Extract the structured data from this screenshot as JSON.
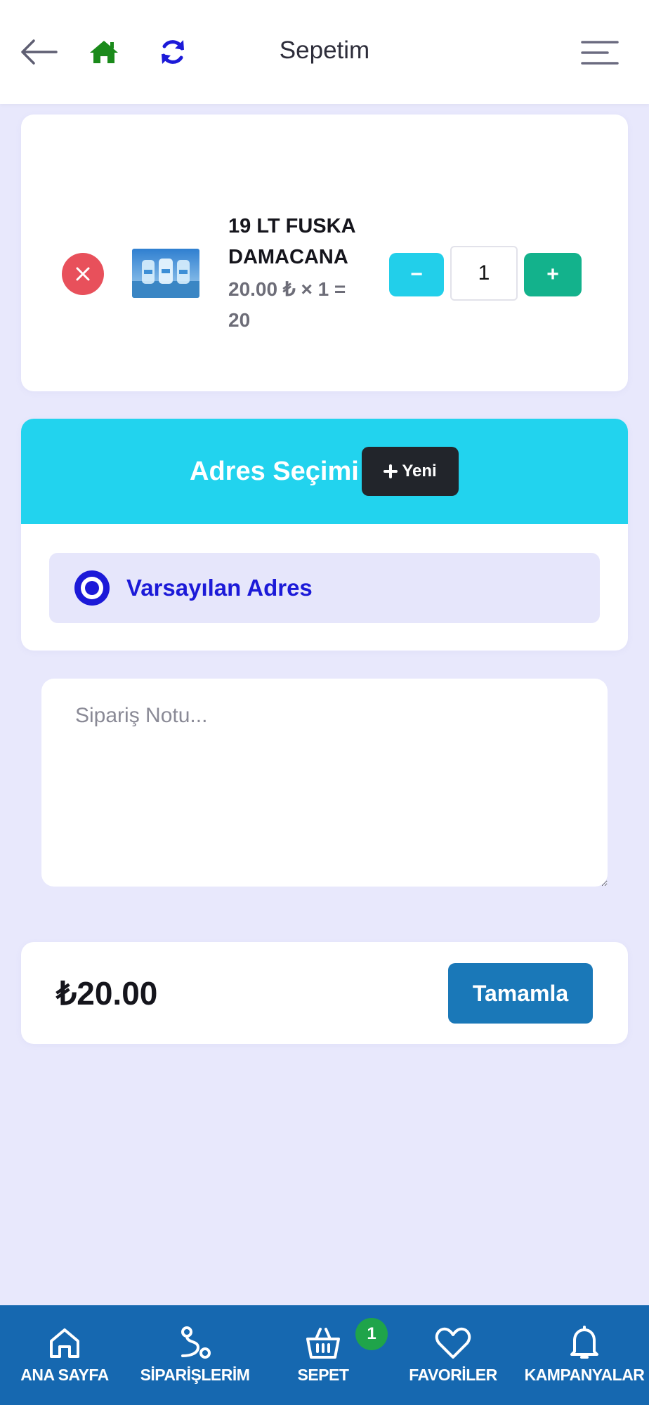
{
  "header": {
    "title": "Sepetim",
    "icons": [
      "arrow-left-icon",
      "home-icon",
      "refresh-icon",
      "menu-icon"
    ],
    "home_icon_color": "#1a8a1a",
    "refresh_icon_color": "#1c1ad8"
  },
  "cart": {
    "items": [
      {
        "name": "19 LT FUSKA DAMACANA",
        "price_line": "20.00 ₺ × 1 = 20",
        "quantity": "1",
        "minus_label": "−",
        "plus_label": "+"
      }
    ]
  },
  "address": {
    "title": "Adres Seçimi",
    "new_button_label": "Yeni",
    "options": [
      {
        "label": "Varsayılan Adres",
        "selected": true
      }
    ]
  },
  "order_note": {
    "placeholder": "Sipariş Notu..."
  },
  "summary": {
    "total": "₺20.00",
    "complete_label": "Tamamla"
  },
  "bottom_nav": {
    "items": [
      {
        "label": "ANA SAYFA",
        "icon": "home-outline-icon"
      },
      {
        "label": "SİPARİŞLERİM",
        "icon": "route-icon"
      },
      {
        "label": "SEPET",
        "icon": "basket-icon",
        "badge": "1"
      },
      {
        "label": "FAVORİLER",
        "icon": "heart-icon"
      },
      {
        "label": "KAMPANYALAR",
        "icon": "bell-icon"
      }
    ]
  },
  "colors": {
    "background": "#e8e8fc",
    "accent_cyan": "#22d3ee",
    "primary_blue": "#1a78b8",
    "nav_blue": "#1668b0",
    "success_green": "#13b28c",
    "danger_red": "#e8505b",
    "radio_blue": "#1c1ad8"
  }
}
